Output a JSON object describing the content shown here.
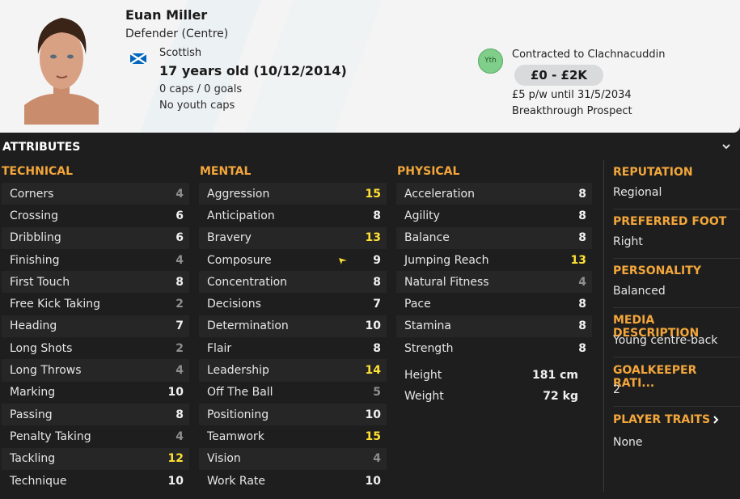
{
  "player": {
    "name": "Euan Miller",
    "position": "Defender (Centre)",
    "nationality": "Scottish",
    "age": "17 years old (10/12/2014)",
    "caps": "0 caps / 0 goals",
    "youth_caps": "No youth caps"
  },
  "contract": {
    "badge": "Yth",
    "contracted": "Contracted to Clachnacuddin",
    "value": "£0 - £2K",
    "wage": "£5 p/w until 31/5/2034",
    "status": "Breakthrough Prospect"
  },
  "panel": {
    "title": "ATTRIBUTES"
  },
  "technical": {
    "heading": "TECHNICAL",
    "items": [
      {
        "label": "Corners",
        "value": "4",
        "tier": "low"
      },
      {
        "label": "Crossing",
        "value": "6",
        "tier": "mid"
      },
      {
        "label": "Dribbling",
        "value": "6",
        "tier": "mid"
      },
      {
        "label": "Finishing",
        "value": "4",
        "tier": "low"
      },
      {
        "label": "First Touch",
        "value": "8",
        "tier": "mid"
      },
      {
        "label": "Free Kick Taking",
        "value": "2",
        "tier": "low"
      },
      {
        "label": "Heading",
        "value": "7",
        "tier": "mid"
      },
      {
        "label": "Long Shots",
        "value": "2",
        "tier": "low"
      },
      {
        "label": "Long Throws",
        "value": "4",
        "tier": "low"
      },
      {
        "label": "Marking",
        "value": "10",
        "tier": "mid"
      },
      {
        "label": "Passing",
        "value": "8",
        "tier": "mid"
      },
      {
        "label": "Penalty Taking",
        "value": "4",
        "tier": "low"
      },
      {
        "label": "Tackling",
        "value": "12",
        "tier": "hi"
      },
      {
        "label": "Technique",
        "value": "10",
        "tier": "mid"
      }
    ]
  },
  "mental": {
    "heading": "MENTAL",
    "items": [
      {
        "label": "Aggression",
        "value": "15",
        "tier": "hi"
      },
      {
        "label": "Anticipation",
        "value": "8",
        "tier": "mid"
      },
      {
        "label": "Bravery",
        "value": "13",
        "tier": "hi"
      },
      {
        "label": "Composure",
        "value": "9",
        "tier": "mid"
      },
      {
        "label": "Concentration",
        "value": "8",
        "tier": "mid"
      },
      {
        "label": "Decisions",
        "value": "7",
        "tier": "mid"
      },
      {
        "label": "Determination",
        "value": "10",
        "tier": "mid"
      },
      {
        "label": "Flair",
        "value": "8",
        "tier": "mid"
      },
      {
        "label": "Leadership",
        "value": "14",
        "tier": "hi"
      },
      {
        "label": "Off The Ball",
        "value": "5",
        "tier": "low"
      },
      {
        "label": "Positioning",
        "value": "10",
        "tier": "mid"
      },
      {
        "label": "Teamwork",
        "value": "15",
        "tier": "hi"
      },
      {
        "label": "Vision",
        "value": "4",
        "tier": "low"
      },
      {
        "label": "Work Rate",
        "value": "10",
        "tier": "mid"
      }
    ]
  },
  "physical": {
    "heading": "PHYSICAL",
    "items": [
      {
        "label": "Acceleration",
        "value": "8",
        "tier": "mid"
      },
      {
        "label": "Agility",
        "value": "8",
        "tier": "mid"
      },
      {
        "label": "Balance",
        "value": "8",
        "tier": "mid"
      },
      {
        "label": "Jumping Reach",
        "value": "13",
        "tier": "hi"
      },
      {
        "label": "Natural Fitness",
        "value": "4",
        "tier": "low"
      },
      {
        "label": "Pace",
        "value": "8",
        "tier": "mid"
      },
      {
        "label": "Stamina",
        "value": "8",
        "tier": "mid"
      },
      {
        "label": "Strength",
        "value": "8",
        "tier": "mid"
      }
    ],
    "height_label": "Height",
    "height": "181 cm",
    "weight_label": "Weight",
    "weight": "72 kg"
  },
  "side": {
    "reputation_h": "REPUTATION",
    "reputation": "Regional",
    "foot_h": "PREFERRED FOOT",
    "foot": "Right",
    "personality_h": "PERSONALITY",
    "personality": "Balanced",
    "media_h": "MEDIA DESCRIPTION",
    "media": "Young centre-back",
    "gk_h": "GOALKEEPER RATI...",
    "gk": "2",
    "traits_h": "PLAYER TRAITS",
    "traits": "None"
  },
  "colors": {
    "accent": "#f3a63a",
    "high": "#ffe234",
    "low": "#8f8f8f"
  }
}
